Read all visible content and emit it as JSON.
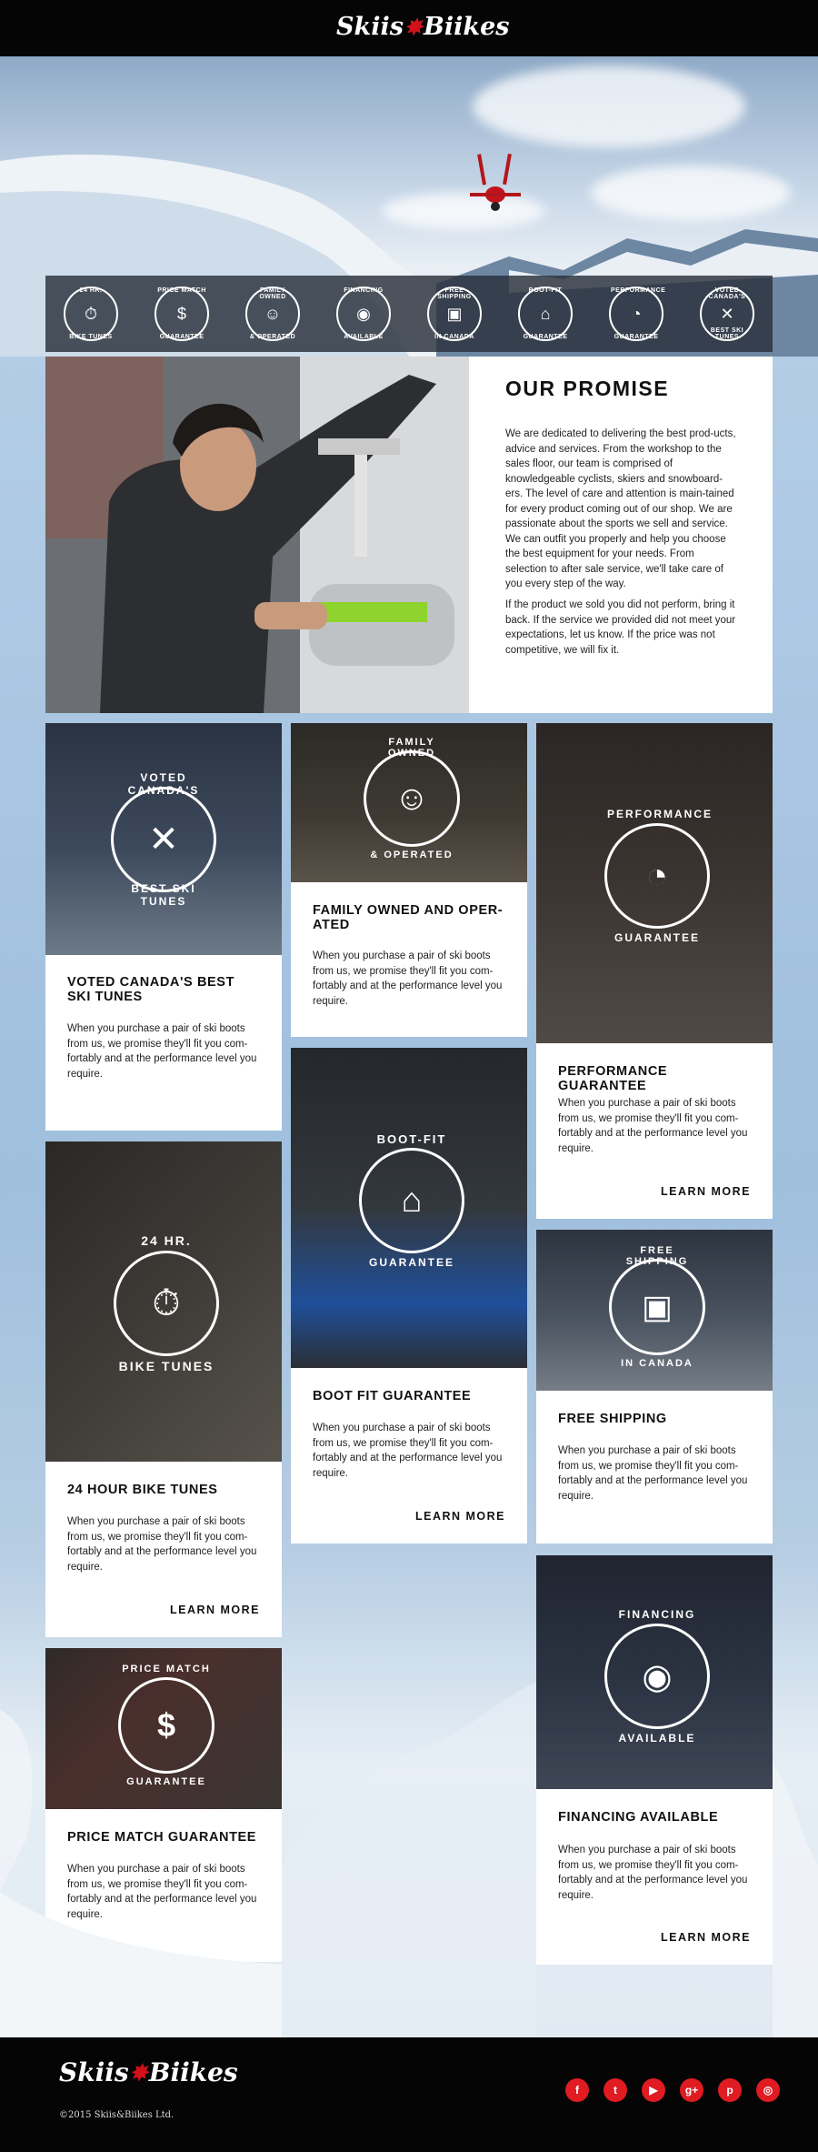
{
  "brand": {
    "name_left": "Skiis",
    "amp": "&",
    "name_right": "Biikes"
  },
  "badges": [
    {
      "top": "24 HR.",
      "bottom": "BIKE TUNES",
      "icon": "⏱"
    },
    {
      "top": "PRICE MATCH",
      "bottom": "GUARANTEE",
      "icon": "$"
    },
    {
      "top": "FAMILY OWNED",
      "bottom": "& OPERATED",
      "icon": "☺"
    },
    {
      "top": "FINANCING",
      "bottom": "AVAILABLE",
      "icon": "◉"
    },
    {
      "top": "FREE SHIPPING",
      "bottom": "IN CANADA",
      "icon": "▣"
    },
    {
      "top": "BOOT-FIT",
      "bottom": "GUARANTEE",
      "icon": "⌂"
    },
    {
      "top": "PERFORMANCE",
      "bottom": "GUARANTEE",
      "icon": "◔"
    },
    {
      "top": "VOTED CANADA'S",
      "bottom": "BEST SKI TUNES",
      "icon": "✕"
    }
  ],
  "promise": {
    "title": "OUR PROMISE",
    "p1": "We are dedicated to delivering the best prod-ucts, advice and services. From the workshop to the sales floor, our team is comprised of knowledgeable cyclists, skiers and snowboard-ers. The level of care and attention is main-tained for every product coming out of our shop. We are passionate about the sports we sell and service. We can outfit you properly and help you choose the best equipment for your needs. From selection to after sale service, we'll take care of you every step of the way.",
    "p2": "If the product we sold you did not perform, bring it back. If the service we provided did not meet your expectations, let us know. If the price was not competitive, we will fix it."
  },
  "cards": {
    "voted": {
      "title": "VOTED CANADA'S BEST SKI TUNES",
      "text": "When you purchase a pair of ski boots from us, we promise they'll fit you com-fortably and at the performance level you require.",
      "em_top": "VOTED CANADA'S",
      "em_bottom": "BEST SKI TUNES"
    },
    "family": {
      "title": "FAMILY OWNED AND OPER-ATED",
      "text": "When you purchase a pair of ski boots from us, we promise they'll fit you com-fortably and at the performance level you require.",
      "em_top": "FAMILY OWNED",
      "em_bottom": "& OPERATED"
    },
    "performance": {
      "title": "PERFORMANCE GUARANTEE",
      "text": "When you purchase a pair of ski boots from us, we promise they'll fit you com-fortably and at the performance level you require.",
      "em_top": "PERFORMANCE",
      "em_bottom": "GUARANTEE",
      "learn": "LEARN MORE"
    },
    "bike": {
      "title": "24 HOUR BIKE TUNES",
      "text": "When you purchase a pair of ski boots from us, we promise they'll fit you com-fortably and at the performance level you require.",
      "em_top": "24 HR.",
      "em_bottom": "BIKE TUNES",
      "learn": "LEARN MORE"
    },
    "boot": {
      "title": "BOOT FIT GUARANTEE",
      "text": "When you purchase a pair of ski boots from us, we promise they'll fit you com-fortably and at the performance level you require.",
      "em_top": "BOOT-FIT",
      "em_bottom": "GUARANTEE",
      "learn": "LEARN MORE"
    },
    "shipping": {
      "title": "FREE SHIPPING",
      "text": "When you purchase a pair of ski boots from us, we promise they'll fit you com-fortably and at the performance level you require.",
      "em_top": "FREE SHIPPING",
      "em_bottom": "IN CANADA"
    },
    "price": {
      "title": "PRICE MATCH GUARANTEE",
      "text": "When you purchase a pair of ski boots from us, we promise they'll fit you com-fortably and at the performance level you require.",
      "em_top": "PRICE MATCH",
      "em_bottom": "GUARANTEE"
    },
    "financing": {
      "title": "FINANCING AVAILABLE",
      "text": "When you purchase a pair of ski boots from us, we promise they'll fit you com-fortably and at the performance level you require.",
      "em_top": "FINANCING",
      "em_bottom": "AVAILABLE",
      "learn": "LEARN MORE"
    }
  },
  "footer": {
    "copyright": "©2015 Skiis&Biikes Ltd."
  },
  "social": [
    {
      "icon": "facebook-icon",
      "glyph": "f"
    },
    {
      "icon": "twitter-icon",
      "glyph": "t"
    },
    {
      "icon": "youtube-icon",
      "glyph": "▶"
    },
    {
      "icon": "google-plus-icon",
      "glyph": "g+"
    },
    {
      "icon": "pinterest-icon",
      "glyph": "p"
    },
    {
      "icon": "instagram-icon",
      "glyph": "◎"
    }
  ],
  "colors": {
    "accent": "#d2121b",
    "dark": "#050505"
  }
}
